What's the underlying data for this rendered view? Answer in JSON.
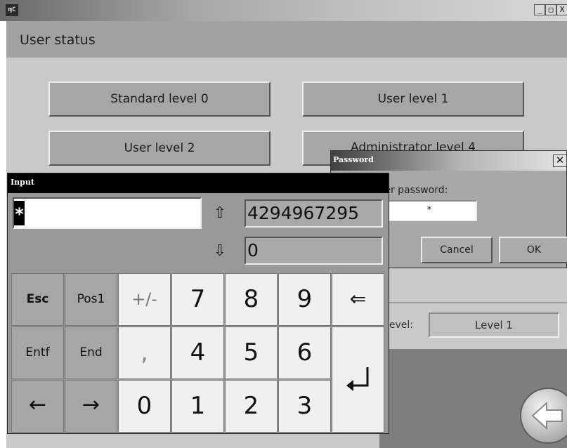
{
  "window": {
    "logo_text": "ɱC",
    "controls": {
      "minimize": "_",
      "maximize": "□",
      "close": "X"
    }
  },
  "screen": {
    "title": "User status",
    "level_buttons": {
      "level0": "Standard level 0",
      "level1": "User level 1",
      "level2": "User level 2",
      "level4": "Administrator level 4"
    },
    "current_level_label": "t level:",
    "current_level_value": "Level 1"
  },
  "password_dialog": {
    "title": "Password",
    "close": "✕",
    "prompt": "nter password:",
    "masked_value": "*",
    "cancel_label": "Cancel",
    "ok_label": "OK"
  },
  "input_window": {
    "title": "Input",
    "value": "*",
    "max_arrow": "⇧",
    "min_arrow": "⇩",
    "max_value": "4294967295",
    "min_value": "0",
    "keys": {
      "esc": "Esc",
      "pos1": "Pos1",
      "plusminus": "+/-",
      "d7": "7",
      "d8": "8",
      "d9": "9",
      "backspace": "⇐",
      "entf": "Entf",
      "end": "End",
      "comma": ",",
      "d4": "4",
      "d5": "5",
      "d6": "6",
      "left": "←",
      "right": "→",
      "d0": "0",
      "d1": "1",
      "d2": "2",
      "d3": "3"
    }
  }
}
